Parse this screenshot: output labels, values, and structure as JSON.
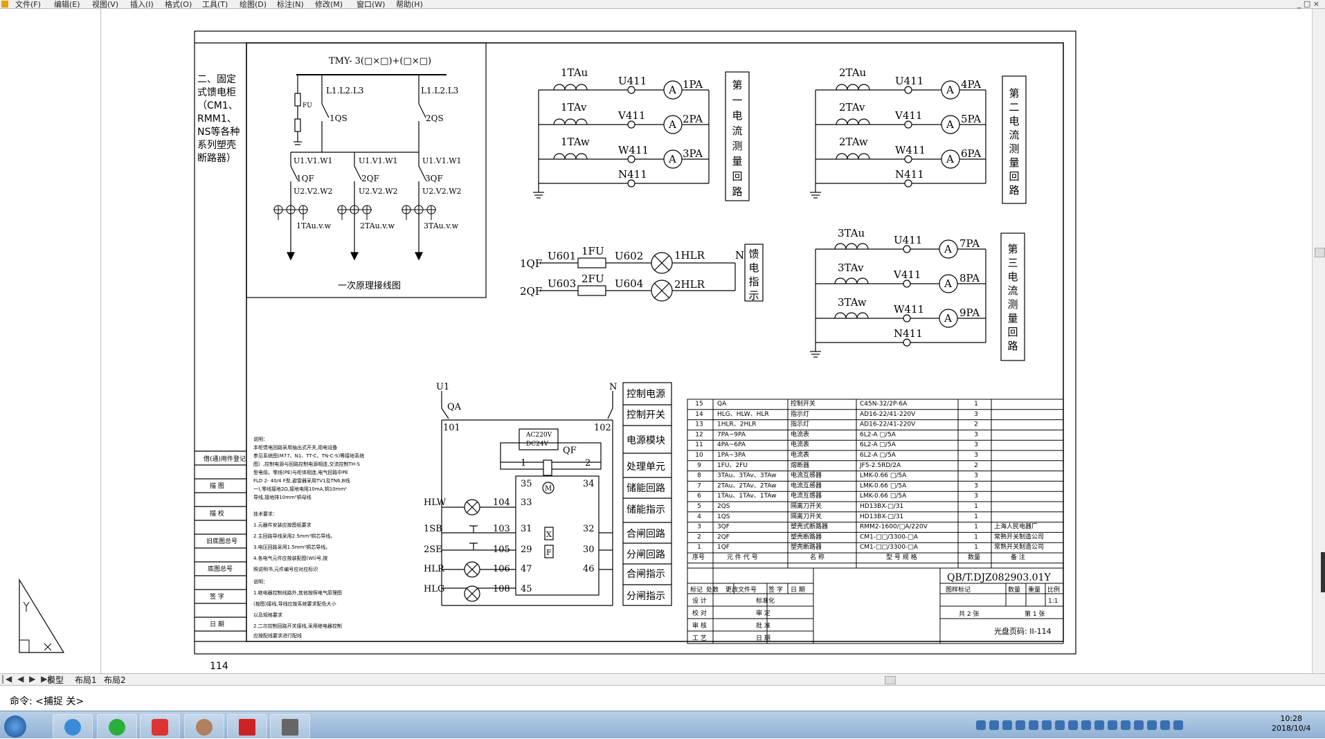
{
  "app": {
    "menus": [
      "文件(F)",
      "编辑(E)",
      "视图(V)",
      "插入(I)",
      "格式(O)",
      "工具(T)",
      "绘图(D)",
      "标注(N)",
      "修改(M)",
      "窗口(W)",
      "帮助(H)"
    ],
    "window_buttons": "_ □ ×"
  },
  "tabs": {
    "nav": "|◀ ◀ ▶ ▶|",
    "items": [
      "模型",
      "布局1",
      "布局2"
    ]
  },
  "command": {
    "text": "命令:  <捕捉 关>"
  },
  "clock": {
    "time": "10:28",
    "date": "2018/10/4"
  },
  "page_number": "114",
  "drawing": {
    "section_title": [
      "二、固定",
      "式馈电柜",
      "（CM1、",
      "RMM1、",
      "NS等各种",
      "系列塑壳",
      "断路器）"
    ],
    "primary": {
      "bus_label": "TMY- 3(□×□)+(□×□)",
      "caption": "一次原理接线图",
      "l123": "L1.L2.L3",
      "qs1": "1QS",
      "qs2": "2QS",
      "fu": "FU",
      "uvw1": "U1.V1.W1",
      "uvw2": "U2.V2.W2",
      "qf": [
        "1QF",
        "2QF",
        "3QF"
      ],
      "ta": [
        "1TAu.v.w",
        "2TAu.v.w",
        "3TAu.v.w"
      ]
    },
    "meter_groups": [
      {
        "ta": [
          "1TAu",
          "1TAv",
          "1TAw"
        ],
        "pa": [
          "1PA",
          "2PA",
          "3PA"
        ],
        "box": [
          "第",
          "一",
          "电",
          "流",
          "测",
          "量",
          "回",
          "路"
        ]
      },
      {
        "ta": [
          "2TAu",
          "2TAv",
          "2TAw"
        ],
        "pa": [
          "4PA",
          "5PA",
          "6PA"
        ],
        "box": [
          "第",
          "二",
          "电",
          "流",
          "测",
          "量",
          "回",
          "路"
        ]
      },
      {
        "ta": [
          "3TAu",
          "3TAv",
          "3TAw"
        ],
        "pa": [
          "7PA",
          "8PA",
          "9PA"
        ],
        "box": [
          "第",
          "三",
          "电",
          "流",
          "测",
          "量",
          "回",
          "路"
        ]
      }
    ],
    "phase_labels": [
      "U411",
      "V411",
      "W411",
      "N411"
    ],
    "ammeter_symbol": "A",
    "feeder": {
      "qf": [
        "1QF",
        "2QF"
      ],
      "u_in": [
        "U601",
        "U603"
      ],
      "fu": [
        "1FU",
        "2FU"
      ],
      "u_out": [
        "U602",
        "U604"
      ],
      "hlr": [
        "1HLR",
        "2HLR"
      ],
      "n": "N",
      "box": [
        "馈",
        "电",
        "指",
        "示"
      ]
    },
    "control": {
      "u1": "U1",
      "n": "N",
      "qa": "QA",
      "n101": "101",
      "n102": "102",
      "psu": [
        "AC220V",
        "DC24V"
      ],
      "qf": "QF",
      "n1": "1",
      "n2": "2",
      "n35": "35",
      "n34": "34",
      "n33": "33",
      "n104": "104",
      "n103": "103",
      "n105": "105",
      "n31": "31",
      "n32": "32",
      "n29": "29",
      "n30": "30",
      "n106": "106",
      "n47": "47",
      "n46": "46",
      "n108": "108",
      "n45": "45",
      "hlw": "HLW",
      "sb1": "1SB",
      "sb2": "2SE",
      "hlr": "HLR",
      "hlg": "HLG",
      "m": "M",
      "x": "X",
      "f": "F",
      "labels": [
        "控制电源",
        "控制开关",
        "电源模块",
        "处理单元",
        "储能回路",
        "储能指示",
        "合闸回路",
        "分闸回路",
        "合闸指示",
        "分闸指示"
      ]
    },
    "notes": {
      "lines": [
        "说明：",
        "  本柜馈电回路采用抽出式开关,用电设备",
        "参见系统图(M77、N1、TT-C、TN-C-S)等接地系统",
        "图）,控制电源与回路控制电源相连,交流控制TH-S",
        "型电缆。零线(PE)与柜体相连,电气回路中PE",
        "FLD 2- 40/4 F型,避雷器采用TV1及TN6,B线",
        "一),零线接地2Ω,接地电阻10mA,铜10mm²",
        "导线,接地排10mm²铜母线",
        "",
        "技术要求：",
        "1.元器件安装应按图纸要求",
        "2.主回路导线采用2.5mm²铜芯导线。",
        "3.电压回路采用1.5mm²铜芯导线。",
        "4.各电气元件应按装配图(WI)号,按",
        "  照说明书,元件编号应对应标识",
        "",
        "说明：",
        "1.继电器控制线路外,其他按照电气原理图",
        "  (按图)接线,导线应按系统要求配色大小",
        "  以及规格要求",
        "2.二次控制回路开关接线,采用继电器控制",
        "  应按配线要求进行配线"
      ]
    },
    "left_labels": [
      "借(通)用件登记",
      "描  图",
      "描  校",
      "旧底图总号",
      "底图总号",
      "签  字",
      "日  期"
    ],
    "bom": {
      "rows": [
        [
          "15",
          "QA",
          "控制开关",
          "C45N-32/2P-6A",
          "1",
          ""
        ],
        [
          "14",
          "HLG、HLW、HLR",
          "指示灯",
          "AD16-22/41-220V",
          "3",
          ""
        ],
        [
          "13",
          "1HLR、2HLR",
          "指示灯",
          "AD16-22/41-220V",
          "2",
          ""
        ],
        [
          "12",
          "7PA~9PA",
          "电流表",
          "6L2-A  □/5A",
          "3",
          ""
        ],
        [
          "11",
          "4PA~6PA",
          "电流表",
          "6L2-A  □/5A",
          "3",
          ""
        ],
        [
          "10",
          "1PA~3PA",
          "电流表",
          "6L2-A  □/5A",
          "3",
          ""
        ],
        [
          "9",
          "1FU、2FU",
          "熔断器",
          "JF5-2.5RD/2A",
          "2",
          ""
        ],
        [
          "8",
          "3TAu、3TAv、3TAw",
          "电流互感器",
          "LMK-0.66  □/5A",
          "3",
          ""
        ],
        [
          "7",
          "2TAu、2TAv、2TAw",
          "电流互感器",
          "LMK-0.66  □/5A",
          "3",
          ""
        ],
        [
          "6",
          "1TAu、1TAv、1TAw",
          "电流互感器",
          "LMK-0.66  □/5A",
          "3",
          ""
        ],
        [
          "5",
          "2QS",
          "隔离刀开关",
          "HD13BX-□/31",
          "1",
          ""
        ],
        [
          "4",
          "1QS",
          "隔离刀开关",
          "HD13BX-□/31",
          "1",
          ""
        ],
        [
          "3",
          "3QF",
          "塑壳式断路器",
          "RMM2-1600/□A/220V",
          "1",
          "上海人民电器厂"
        ],
        [
          "2",
          "2QF",
          "塑壳断路器",
          "CM1-□□/3300-□A",
          "1",
          "常熟开关制造公司"
        ],
        [
          "1",
          "1QF",
          "塑壳断路器",
          "CM1-□□/3300-□A",
          "1",
          "常熟开关制造公司"
        ]
      ],
      "header": [
        "序号",
        "元 件 代 号",
        "名  称",
        "型 号 规 格",
        "数量",
        "备  注"
      ]
    },
    "title_block": {
      "code": "QB/T.DJZ082903.01Y",
      "h1": [
        "图样标记",
        "数量",
        "重量",
        "比例"
      ],
      "scale": "1:1",
      "sheets": "共 2 张",
      "sheet": "第 1 张",
      "disc": "光盘页码: II-114",
      "rev_header": [
        "标记",
        "处数",
        "更改文件号",
        "签  字",
        "日  期"
      ],
      "roles": [
        "设  计",
        "校  对",
        "审  核",
        "工  艺"
      ],
      "roles2": [
        "标准化",
        "审  定",
        "批  准",
        "日  期"
      ]
    }
  }
}
